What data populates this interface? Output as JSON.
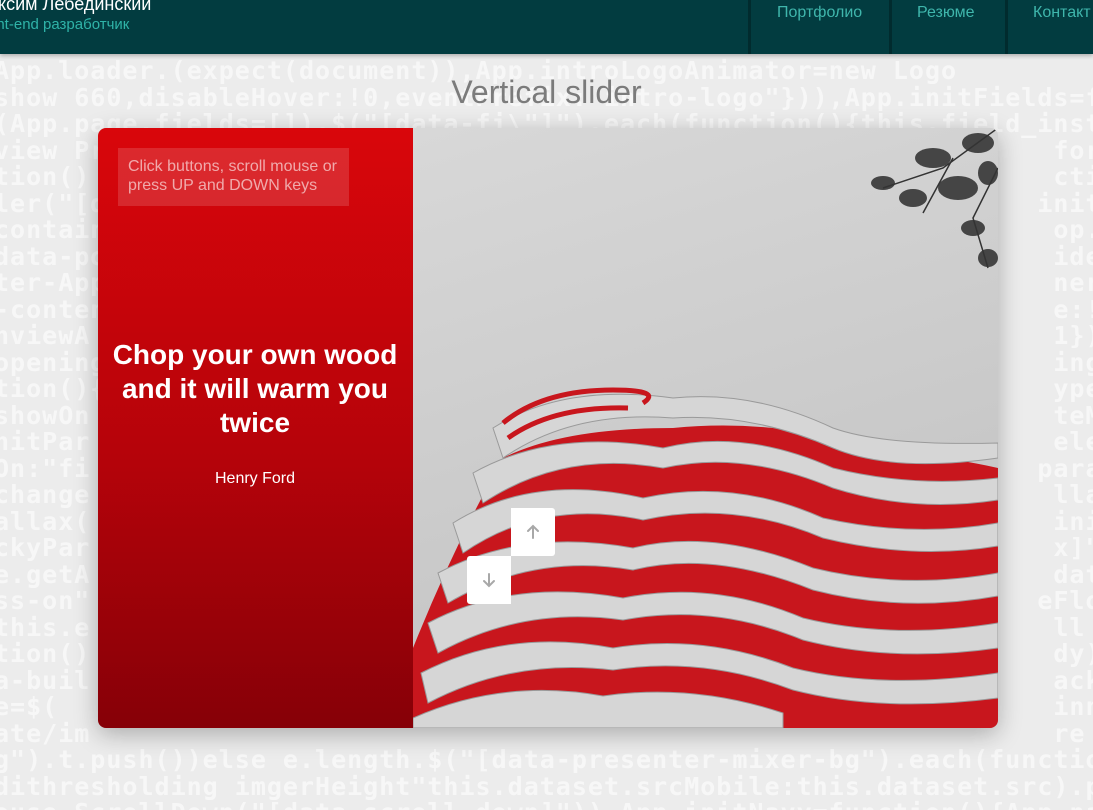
{
  "header": {
    "name": "аксим Лебединский",
    "role": "ont-end разработчик",
    "nav": [
      {
        "label": "Портфолио"
      },
      {
        "label": "Резюме"
      },
      {
        "label": "Контакт"
      }
    ]
  },
  "page": {
    "title": "Vertical slider"
  },
  "slider": {
    "hint": "Click buttons, scroll mouse or press UP and DOWN keys",
    "quote": "Chop your own wood and it will warm you twice",
    "author": "Henry Ford",
    "up_icon": "arrow-up-icon",
    "down_icon": "arrow-down-icon"
  },
  "background_code": [
    "App.loader.(expect(document)),App.introLogoAnimator=new Logo",
    "show 660,disableHover:!0,eventPrefix:\"intro-logo\"})),App.initFields=function(e",
    "(App.page.fields=[]).$(\"[data-fi\\\"]\").each(function(){this.field_instance",
    "view Pre                                                          fore",
    "tion()                                                            ction",
    "ler(\"[d                                                          initPop",
    "contain                                                           op.popu",
    "data-po                                                           ideOA",
    "ter-App                                                           ner=ne",
    "-conten                                                           e:!0))",
    "nviewA                                                            1})).",
    "opening                                                           ing(th",
    "tion(){                                                           ypewri",
    "showOn                                                            teMinY",
    "nitPar                                                            electo",
    "On:\"fi                                                           parall",
    "change                                                            llax\"(",
    "allax(                                                            initSt",
    "ckyPar                                                            x]\").e",
    "e.getA                                                            data-",
    "ss-on\"                                                           eFloat",
    "this.e                                                            ll ax",
    "tion()                                                            dy) A",
    "a-buil                                                            ack",
    "e=$(                                                              inner",
    "ate/im                                                            re",
    "g\").t.push())else e.length.$(\"[data-presenter-mixer-bg\").each(function(){va",
    "dithresholding imgerHeight\"this.dataset.srcMobile:this.dataset.src).push(e)})",
    "ouse.ScrollDown(\"[data-scroll-down]\")).App.initNavy=function(){App.nav.a"
  ]
}
